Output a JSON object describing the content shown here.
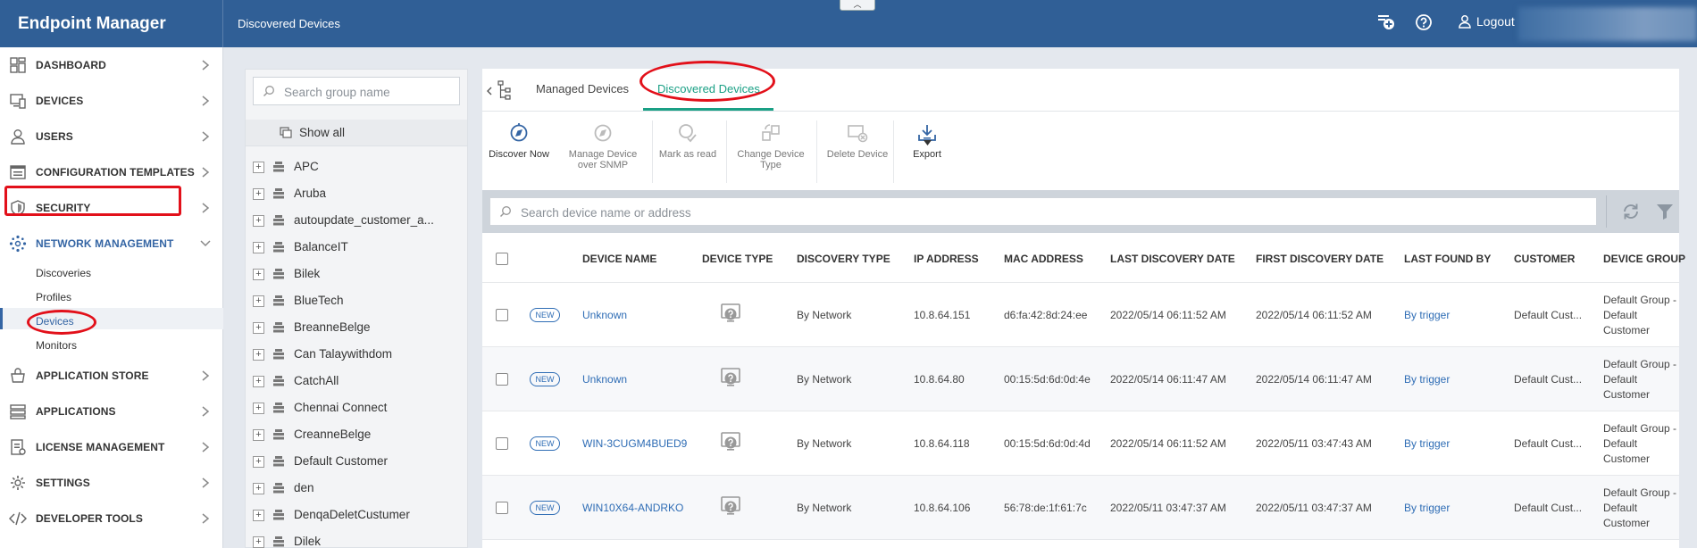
{
  "app": {
    "brand": "Endpoint Manager",
    "page_title": "Discovered Devices",
    "logout_label": "Logout",
    "collapse_glyph": "︿"
  },
  "sidebar": {
    "items": [
      {
        "label": "DASHBOARD",
        "icon": "dashboard-icon"
      },
      {
        "label": "DEVICES",
        "icon": "devices-icon"
      },
      {
        "label": "USERS",
        "icon": "user-icon"
      },
      {
        "label": "CONFIGURATION TEMPLATES",
        "icon": "templates-icon"
      },
      {
        "label": "SECURITY",
        "icon": "shield-icon"
      },
      {
        "label": "NETWORK MANAGEMENT",
        "icon": "network-icon"
      },
      {
        "label": "APPLICATION STORE",
        "icon": "store-icon"
      },
      {
        "label": "APPLICATIONS",
        "icon": "applications-icon"
      },
      {
        "label": "LICENSE MANAGEMENT",
        "icon": "license-icon"
      },
      {
        "label": "SETTINGS",
        "icon": "gear-icon"
      },
      {
        "label": "DEVELOPER TOOLS",
        "icon": "code-icon"
      }
    ],
    "network_sub": [
      "Discoveries",
      "Profiles",
      "Devices",
      "Monitors"
    ]
  },
  "groups": {
    "search_placeholder": "Search group name",
    "show_all": "Show all",
    "items": [
      "APC",
      "Aruba",
      "autoupdate_customer_a...",
      "BalanceIT",
      "Bilek",
      "BlueTech",
      "BreanneBelge",
      "Can Talaywithdom",
      "CatchAll",
      "Chennai Connect",
      "CreanneBelge",
      "Default Customer",
      "den",
      "DenqaDeletCustumer",
      "Dilek"
    ]
  },
  "tabs": {
    "managed": "Managed Devices",
    "discovered": "Discovered Devices"
  },
  "toolbar": {
    "discover_now": "Discover Now",
    "manage_snmp_1": "Manage Device",
    "manage_snmp_2": "over SNMP",
    "mark_read": "Mark as read",
    "change_type_1": "Change Device",
    "change_type_2": "Type",
    "delete_device": "Delete Device",
    "export": "Export"
  },
  "device_search": {
    "placeholder": "Search device name or address"
  },
  "table": {
    "columns": {
      "device_name": "DEVICE NAME",
      "device_type": "DEVICE TYPE",
      "discovery_type": "DISCOVERY TYPE",
      "ip_address": "IP ADDRESS",
      "mac_address": "MAC ADDRESS",
      "last_discovery": "LAST DISCOVERY DATE",
      "first_discovery": "FIRST DISCOVERY DATE",
      "last_found_by": "LAST FOUND BY",
      "customer": "CUSTOMER",
      "device_group": "DEVICE GROUP"
    },
    "rows": [
      {
        "badge": "NEW",
        "name": "Unknown",
        "discovery": "By Network",
        "ip": "10.8.64.151",
        "mac": "d6:fa:42:8d:24:ee",
        "last": "2022/05/14 06:11:52 AM",
        "first": "2022/05/14 06:11:52 AM",
        "found_by": "By trigger",
        "customer": "Default Cust...",
        "group1": "Default Group -",
        "group2": "Default",
        "group3": "Customer"
      },
      {
        "badge": "NEW",
        "name": "Unknown",
        "discovery": "By Network",
        "ip": "10.8.64.80",
        "mac": "00:15:5d:6d:0d:4e",
        "last": "2022/05/14 06:11:47 AM",
        "first": "2022/05/14 06:11:47 AM",
        "found_by": "By trigger",
        "customer": "Default Cust...",
        "group1": "Default Group -",
        "group2": "Default",
        "group3": "Customer"
      },
      {
        "badge": "NEW",
        "name": "WIN-3CUGM4BUED9",
        "discovery": "By Network",
        "ip": "10.8.64.118",
        "mac": "00:15:5d:6d:0d:4d",
        "last": "2022/05/14 06:11:52 AM",
        "first": "2022/05/11 03:47:43 AM",
        "found_by": "By trigger",
        "customer": "Default Cust...",
        "group1": "Default Group -",
        "group2": "Default",
        "group3": "Customer"
      },
      {
        "badge": "NEW",
        "name": "WIN10X64-ANDRKO",
        "discovery": "By Network",
        "ip": "10.8.64.106",
        "mac": "56:78:de:1f:61:7c",
        "last": "2022/05/11 03:47:37 AM",
        "first": "2022/05/11 03:47:37 AM",
        "found_by": "By trigger",
        "customer": "Default Cust...",
        "group1": "Default Group -",
        "group2": "Default",
        "group3": "Customer"
      }
    ]
  },
  "colors": {
    "header": "#305f96",
    "accent_tab": "#1aa085",
    "link": "#2f6db5",
    "highlight": "#e2101a"
  }
}
